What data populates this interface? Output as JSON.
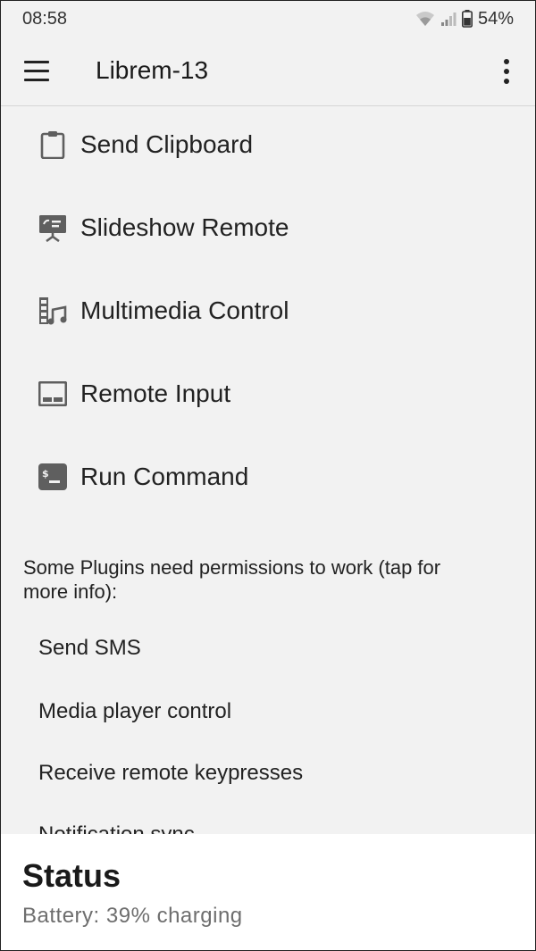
{
  "status_bar": {
    "time": "08:58",
    "battery": "54%"
  },
  "toolbar": {
    "title": "Librem-13"
  },
  "plugins": [
    {
      "label": "Send Clipboard",
      "icon": "clipboard-icon"
    },
    {
      "label": "Slideshow Remote",
      "icon": "presentation-icon"
    },
    {
      "label": "Multimedia Control",
      "icon": "multimedia-icon"
    },
    {
      "label": "Remote Input",
      "icon": "keyboard-icon"
    },
    {
      "label": "Run Command",
      "icon": "terminal-icon"
    }
  ],
  "permissions": {
    "note": "Some Plugins need permissions to work (tap for more info):",
    "items": [
      "Send SMS",
      "Media player control",
      "Receive remote keypresses",
      "Notification sync"
    ]
  },
  "status_sheet": {
    "title": "Status",
    "text": "Battery: 39% charging"
  },
  "colors": {
    "background": "#f2f2f2",
    "icon": "#5f5f5f",
    "sheet": "#ffffff"
  }
}
